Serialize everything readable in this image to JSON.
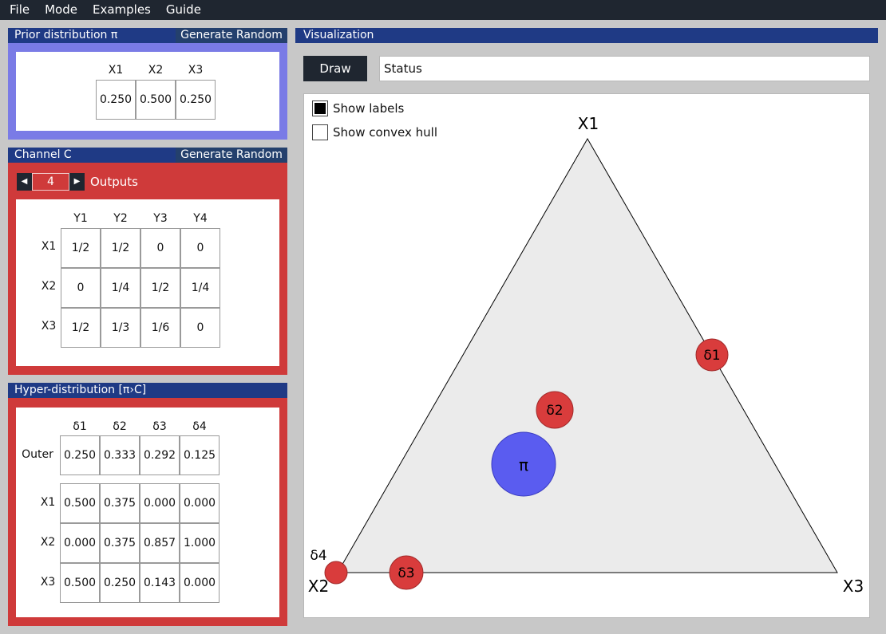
{
  "menu": [
    "File",
    "Mode",
    "Examples",
    "Guide"
  ],
  "prior": {
    "title": "Prior distribution π",
    "generate_label": "Generate Random",
    "headers": [
      "X1",
      "X2",
      "X3"
    ],
    "values": [
      "0.250",
      "0.500",
      "0.250"
    ]
  },
  "channel": {
    "title": "Channel C",
    "generate_label": "Generate Random",
    "outputs_value": "4",
    "outputs_label": "Outputs",
    "col_headers": [
      "Y1",
      "Y2",
      "Y3",
      "Y4"
    ],
    "row_headers": [
      "X1",
      "X2",
      "X3"
    ],
    "rows": [
      [
        "1/2",
        "1/2",
        "0",
        "0"
      ],
      [
        "0",
        "1/4",
        "1/2",
        "1/4"
      ],
      [
        "1/2",
        "1/3",
        "1/6",
        "0"
      ]
    ]
  },
  "hyper": {
    "title": "Hyper-distribution [π›C]",
    "col_headers": [
      "δ1",
      "δ2",
      "δ3",
      "δ4"
    ],
    "outer_label": "Outer",
    "outer": [
      "0.250",
      "0.333",
      "0.292",
      "0.125"
    ],
    "row_headers": [
      "X1",
      "X2",
      "X3"
    ],
    "rows": [
      [
        "0.500",
        "0.375",
        "0.000",
        "0.000"
      ],
      [
        "0.000",
        "0.375",
        "0.857",
        "1.000"
      ],
      [
        "0.500",
        "0.250",
        "0.143",
        "0.000"
      ]
    ]
  },
  "viz": {
    "title": "Visualization",
    "draw_label": "Draw",
    "status_text": "Status",
    "show_labels": "Show labels",
    "show_labels_checked": true,
    "show_hull": "Show convex hull",
    "show_hull_checked": false,
    "vertex_labels": [
      "X1",
      "X2",
      "X3"
    ],
    "prior_label": "π",
    "posterior_labels": [
      "δ1",
      "δ2",
      "δ3",
      "δ4"
    ]
  },
  "colors": {
    "prior_panel": "#7a7be6",
    "red_panel": "#cf3a3a",
    "header_blue": "#1f3a85",
    "prior_circle": "#5a5cf0",
    "posterior_circle": "#d93c3c",
    "triangle_fill": "#ebebeb"
  }
}
